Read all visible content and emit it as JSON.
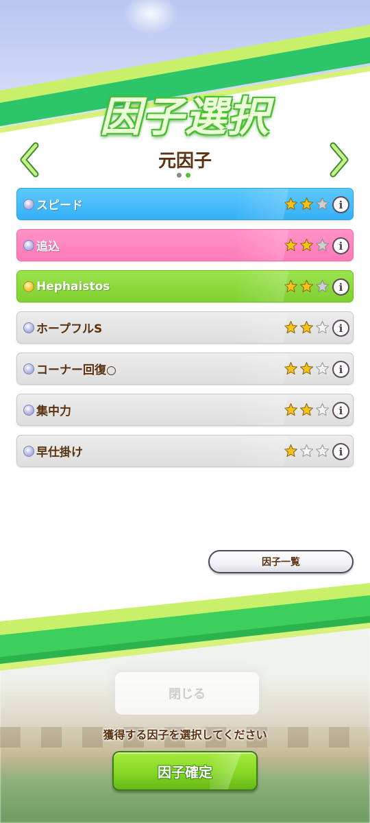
{
  "header": {
    "title": "因子選択",
    "subtitle": "元因子",
    "page_dots": {
      "count": 2,
      "active_index": 1
    }
  },
  "factors": [
    {
      "name": "スピード",
      "color_type": "blue",
      "bullet": "silver",
      "stars": 2,
      "max_stars": 3,
      "info_icon": "i"
    },
    {
      "name": "追込",
      "color_type": "pink",
      "bullet": "silver",
      "stars": 2,
      "max_stars": 3,
      "info_icon": "i"
    },
    {
      "name": "Hephaistos",
      "color_type": "green",
      "bullet": "gold",
      "stars": 2,
      "max_stars": 3,
      "info_icon": "i"
    },
    {
      "name": "ホープフルS",
      "color_type": "gray",
      "bullet": "silver",
      "stars": 2,
      "max_stars": 3,
      "info_icon": "i"
    },
    {
      "name": "コーナー回復○",
      "color_type": "gray",
      "bullet": "silver",
      "stars": 2,
      "max_stars": 3,
      "info_icon": "i"
    },
    {
      "name": "集中力",
      "color_type": "gray",
      "bullet": "silver",
      "stars": 2,
      "max_stars": 3,
      "info_icon": "i"
    },
    {
      "name": "早仕掛け",
      "color_type": "gray",
      "bullet": "silver",
      "stars": 1,
      "max_stars": 3,
      "info_icon": "i"
    }
  ],
  "buttons": {
    "factor_list": "因子一覧",
    "confirm": "因子確定",
    "background_blurred": "閉じる"
  },
  "instruction": "獲得する因子を選択してください",
  "colors": {
    "accent_green": "#7ed12e",
    "title_text": "#5a3210",
    "speed_blue": "#35b0f5",
    "strategy_pink": "#ff7ab8",
    "unique_green": "#7ed12e",
    "skill_gray": "#dedede",
    "star_filled": "#f5c21b",
    "star_empty_blue_row": "#cfcfcf"
  },
  "icons": [
    "chevron-left-icon",
    "chevron-right-icon",
    "star-icon",
    "info-icon"
  ]
}
